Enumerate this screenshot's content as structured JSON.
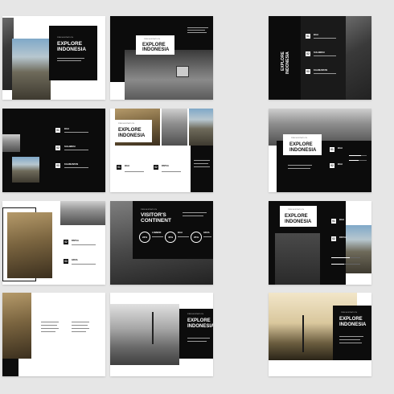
{
  "kicker": "PRESENTATION",
  "title_line1": "EXPLORE",
  "title_line2": "INDONESIA",
  "visitor_line1": "VISITOR'S",
  "visitor_line2": "CONTINENT",
  "places": [
    "BALI",
    "SULAWESI",
    "KALIMANTAN",
    "PAPUA",
    "GRUA"
  ],
  "numbers": [
    "01",
    "02",
    "03"
  ],
  "stats": [
    {
      "label": "LOMBOK",
      "value": "23%"
    },
    {
      "label": "BALI",
      "value": "45%"
    },
    {
      "label": "GRUA",
      "value": "25%"
    }
  ],
  "colors": {
    "bg": "#e6e6e6",
    "black": "#0c0c0c",
    "white": "#ffffff"
  }
}
